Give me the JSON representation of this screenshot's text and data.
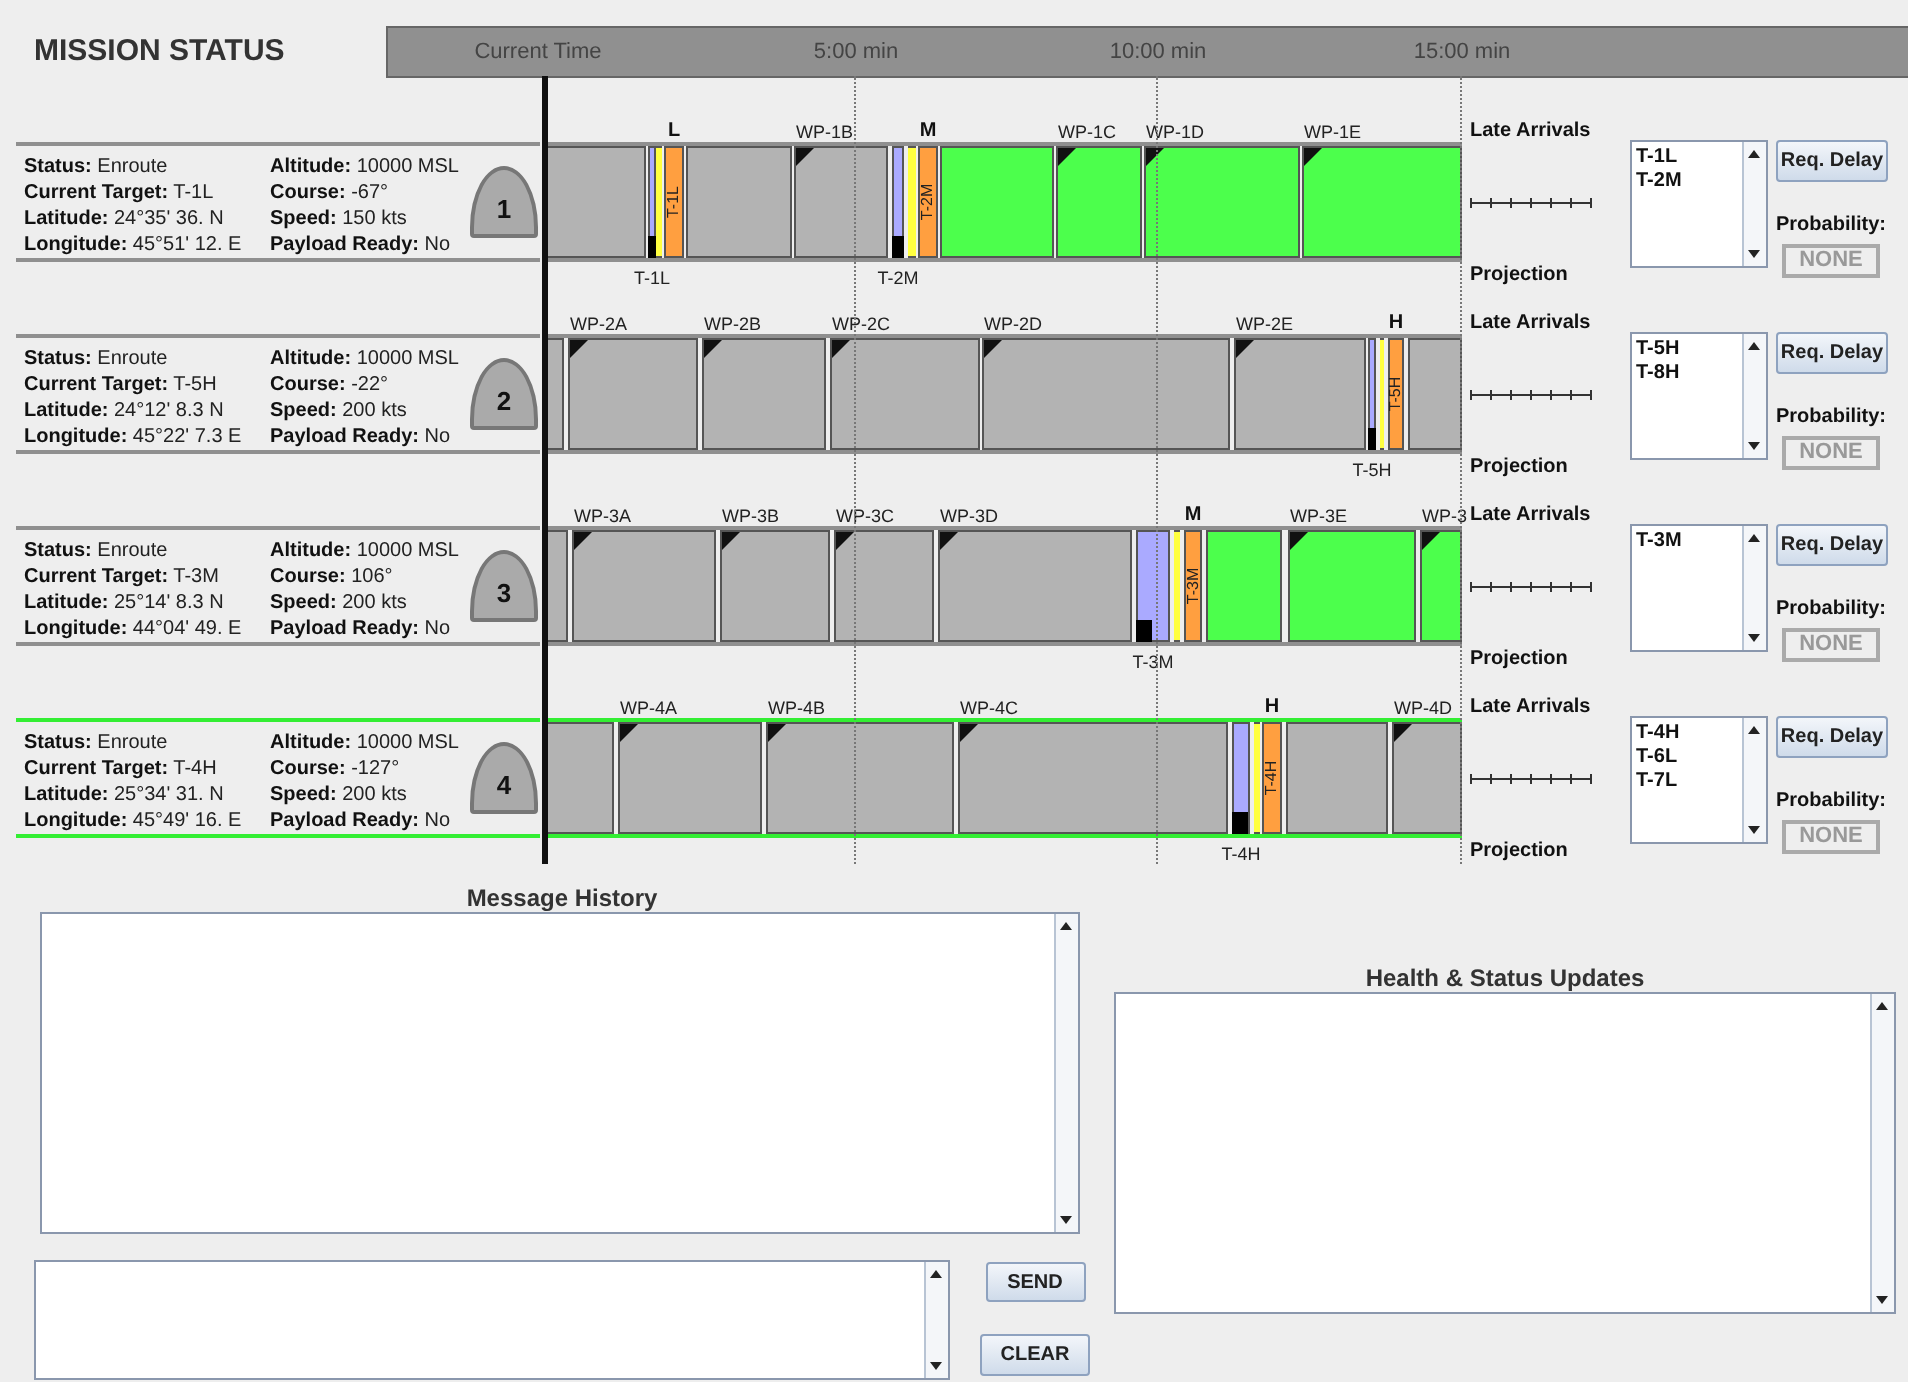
{
  "title": "MISSION STATUS",
  "time_labels": [
    "Current Time",
    "5:00 min",
    "10:00 min",
    "15:00 min"
  ],
  "lanes": [
    {
      "number": "1",
      "selected": false,
      "fields": [
        {
          "label": "Status:",
          "value": "Enroute"
        },
        {
          "label": "Current Target:",
          "value": "T-1L"
        },
        {
          "label": "Latitude:",
          "value": "24°35' 36. N"
        },
        {
          "label": "Longitude:",
          "value": "45°51' 12. E"
        },
        {
          "label": "Altitude:",
          "value": "10000 MSL"
        },
        {
          "label": "Course:",
          "value": "-67°"
        },
        {
          "label": "Speed:",
          "value": "150 kts"
        },
        {
          "label": "Payload Ready:",
          "value": "No"
        }
      ],
      "segments": [
        {
          "kind": "leg",
          "color": "#b3b3b3"
        },
        {
          "kind": "arrival",
          "color": "#aaaaff",
          "bottom_label": "T-1L"
        },
        {
          "kind": "buffer",
          "color": "#ffff40"
        },
        {
          "kind": "target",
          "color": "#ff9f40",
          "text": "T-1L",
          "top_label": "L"
        },
        {
          "kind": "leg",
          "color": "#b3b3b3"
        },
        {
          "kind": "leg",
          "color": "#b3b3b3",
          "waypoint": "WP-1B"
        },
        {
          "kind": "arrival",
          "color": "#aaaaff",
          "bottom_label": "T-2M"
        },
        {
          "kind": "buffer",
          "color": "#ffff40"
        },
        {
          "kind": "target",
          "color": "#ff9f40",
          "text": "T-2M",
          "top_label": "M"
        },
        {
          "kind": "leg",
          "color": "#4cff4c"
        },
        {
          "kind": "leg",
          "color": "#4cff4c",
          "waypoint": "WP-1C"
        },
        {
          "kind": "leg",
          "color": "#4cff4c",
          "waypoint": "WP-1D"
        },
        {
          "kind": "leg",
          "color": "#4cff4c",
          "waypoint": "WP-1E"
        }
      ],
      "late_arrivals_label": "Late Arrivals",
      "projection_label": "Projection",
      "late_targets": [
        "T-1L",
        "T-2M"
      ],
      "delay_button": "Req. Delay",
      "probability_label": "Probability:",
      "probability": "NONE"
    },
    {
      "number": "2",
      "selected": false,
      "fields": [
        {
          "label": "Status:",
          "value": "Enroute"
        },
        {
          "label": "Current Target:",
          "value": "T-5H"
        },
        {
          "label": "Latitude:",
          "value": "24°12' 8.3 N"
        },
        {
          "label": "Longitude:",
          "value": "45°22' 7.3 E"
        },
        {
          "label": "Altitude:",
          "value": "10000 MSL"
        },
        {
          "label": "Course:",
          "value": "-22°"
        },
        {
          "label": "Speed:",
          "value": "200 kts"
        },
        {
          "label": "Payload Ready:",
          "value": "No"
        }
      ],
      "segments": [
        {
          "kind": "leg",
          "color": "#b3b3b3"
        },
        {
          "kind": "leg",
          "color": "#b3b3b3",
          "waypoint": "WP-2A"
        },
        {
          "kind": "leg",
          "color": "#b3b3b3",
          "waypoint": "WP-2B"
        },
        {
          "kind": "leg",
          "color": "#b3b3b3",
          "waypoint": "WP-2C"
        },
        {
          "kind": "leg",
          "color": "#b3b3b3",
          "waypoint": "WP-2D"
        },
        {
          "kind": "leg",
          "color": "#b3b3b3",
          "waypoint": "WP-2E"
        },
        {
          "kind": "arrival",
          "color": "#aaaaff",
          "bottom_label": "T-5H"
        },
        {
          "kind": "buffer",
          "color": "#ffff40"
        },
        {
          "kind": "target",
          "color": "#ff9f40",
          "text": "T-5H",
          "top_label": "H"
        },
        {
          "kind": "leg",
          "color": "#b3b3b3"
        }
      ],
      "late_arrivals_label": "Late Arrivals",
      "projection_label": "Projection",
      "late_targets": [
        "T-5H",
        "T-8H"
      ],
      "delay_button": "Req. Delay",
      "probability_label": "Probability:",
      "probability": "NONE"
    },
    {
      "number": "3",
      "selected": false,
      "fields": [
        {
          "label": "Status:",
          "value": "Enroute"
        },
        {
          "label": "Current Target:",
          "value": "T-3M"
        },
        {
          "label": "Latitude:",
          "value": "25°14' 8.3 N"
        },
        {
          "label": "Longitude:",
          "value": "44°04' 49. E"
        },
        {
          "label": "Altitude:",
          "value": "10000 MSL"
        },
        {
          "label": "Course:",
          "value": "106°"
        },
        {
          "label": "Speed:",
          "value": "200 kts"
        },
        {
          "label": "Payload Ready:",
          "value": "No"
        }
      ],
      "segments": [
        {
          "kind": "leg",
          "color": "#b3b3b3"
        },
        {
          "kind": "leg",
          "color": "#b3b3b3",
          "waypoint": "WP-3A"
        },
        {
          "kind": "leg",
          "color": "#b3b3b3",
          "waypoint": "WP-3B"
        },
        {
          "kind": "leg",
          "color": "#b3b3b3",
          "waypoint": "WP-3C"
        },
        {
          "kind": "leg",
          "color": "#b3b3b3",
          "waypoint": "WP-3D"
        },
        {
          "kind": "arrival",
          "color": "#aaaaff",
          "bottom_label": "T-3M"
        },
        {
          "kind": "buffer",
          "color": "#ffff40"
        },
        {
          "kind": "target",
          "color": "#ff9f40",
          "text": "T-3M",
          "top_label": "M"
        },
        {
          "kind": "leg",
          "color": "#4cff4c"
        },
        {
          "kind": "leg",
          "color": "#4cff4c",
          "waypoint": "WP-3E"
        },
        {
          "kind": "leg",
          "color": "#4cff4c",
          "waypoint": "WP-3"
        }
      ],
      "late_arrivals_label": "Late Arrivals",
      "projection_label": "Projection",
      "late_targets": [
        "T-3M"
      ],
      "delay_button": "Req. Delay",
      "probability_label": "Probability:",
      "probability": "NONE"
    },
    {
      "number": "4",
      "selected": true,
      "fields": [
        {
          "label": "Status:",
          "value": "Enroute"
        },
        {
          "label": "Current Target:",
          "value": "T-4H"
        },
        {
          "label": "Latitude:",
          "value": "25°34' 31. N"
        },
        {
          "label": "Longitude:",
          "value": "45°49' 16. E"
        },
        {
          "label": "Altitude:",
          "value": "10000 MSL"
        },
        {
          "label": "Course:",
          "value": "-127°"
        },
        {
          "label": "Speed:",
          "value": "200 kts"
        },
        {
          "label": "Payload Ready:",
          "value": "No"
        }
      ],
      "segments": [
        {
          "kind": "leg",
          "color": "#b3b3b3"
        },
        {
          "kind": "leg",
          "color": "#b3b3b3",
          "waypoint": "WP-4A"
        },
        {
          "kind": "leg",
          "color": "#b3b3b3",
          "waypoint": "WP-4B"
        },
        {
          "kind": "leg",
          "color": "#b3b3b3",
          "waypoint": "WP-4C"
        },
        {
          "kind": "arrival",
          "color": "#aaaaff",
          "bottom_label": "T-4H"
        },
        {
          "kind": "buffer",
          "color": "#ffff40"
        },
        {
          "kind": "target",
          "color": "#ff9f40",
          "text": "T-4H",
          "top_label": "H"
        },
        {
          "kind": "leg",
          "color": "#b3b3b3"
        },
        {
          "kind": "leg",
          "color": "#b3b3b3",
          "waypoint": "WP-4D"
        }
      ],
      "late_arrivals_label": "Late Arrivals",
      "projection_label": "Projection",
      "late_targets": [
        "T-4H",
        "T-6L",
        "T-7L"
      ],
      "delay_button": "Req. Delay",
      "probability_label": "Probability:",
      "probability": "NONE"
    }
  ],
  "message_history": {
    "title": "Message History"
  },
  "buttons": [
    "SEND",
    "CLEAR"
  ],
  "health_updates": {
    "title": "Health & Status Updates"
  }
}
